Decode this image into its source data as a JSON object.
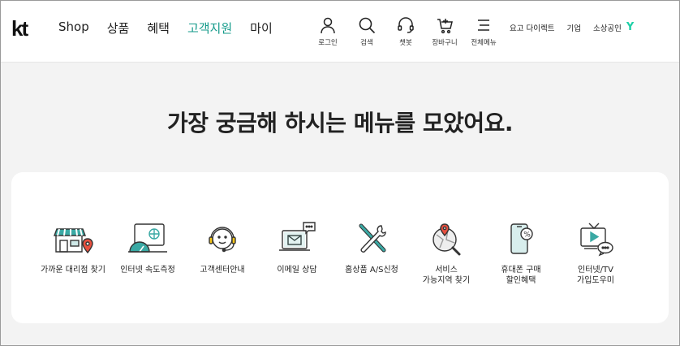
{
  "header": {
    "logo": "kt",
    "nav": [
      "Shop",
      "상품",
      "혜택",
      "고객지원",
      "마이"
    ],
    "active_nav": "고객지원",
    "utils": [
      {
        "label": "로그인",
        "icon": "person-icon"
      },
      {
        "label": "검색",
        "icon": "search-icon"
      },
      {
        "label": "챗봇",
        "icon": "headset-icon"
      },
      {
        "label": "장바구니",
        "icon": "cart-icon"
      },
      {
        "label": "전체메뉴",
        "icon": "menu-icon"
      }
    ],
    "links": [
      "요고 다이렉트",
      "기업",
      "소상공인"
    ],
    "brand_icon": "Y"
  },
  "main": {
    "headline": "가장 궁금해 하시는 메뉴를 모았어요.",
    "quick_menu": [
      {
        "label": "가까운 대리점 찾기",
        "icon": "store-location-icon"
      },
      {
        "label": "인터넷 속도측정",
        "icon": "speed-gauge-icon"
      },
      {
        "label": "고객센터안내",
        "icon": "headset-smile-icon"
      },
      {
        "label": "이메일 상담",
        "icon": "email-laptop-icon"
      },
      {
        "label": "홈상품 A/S신청",
        "icon": "tools-icon"
      },
      {
        "label": "서비스\n가능지역 찾기",
        "icon": "map-magnifier-icon"
      },
      {
        "label": "휴대폰 구매\n할인혜택",
        "icon": "phone-discount-icon"
      },
      {
        "label": "인터넷/TV\n가입도우미",
        "icon": "tv-chat-icon"
      }
    ]
  },
  "colors": {
    "accent": "#139a8a",
    "teal_icon": "#3aa9a4",
    "red_pin": "#e8503f",
    "yellow": "#f5c518",
    "background": "#f3f3f3"
  }
}
